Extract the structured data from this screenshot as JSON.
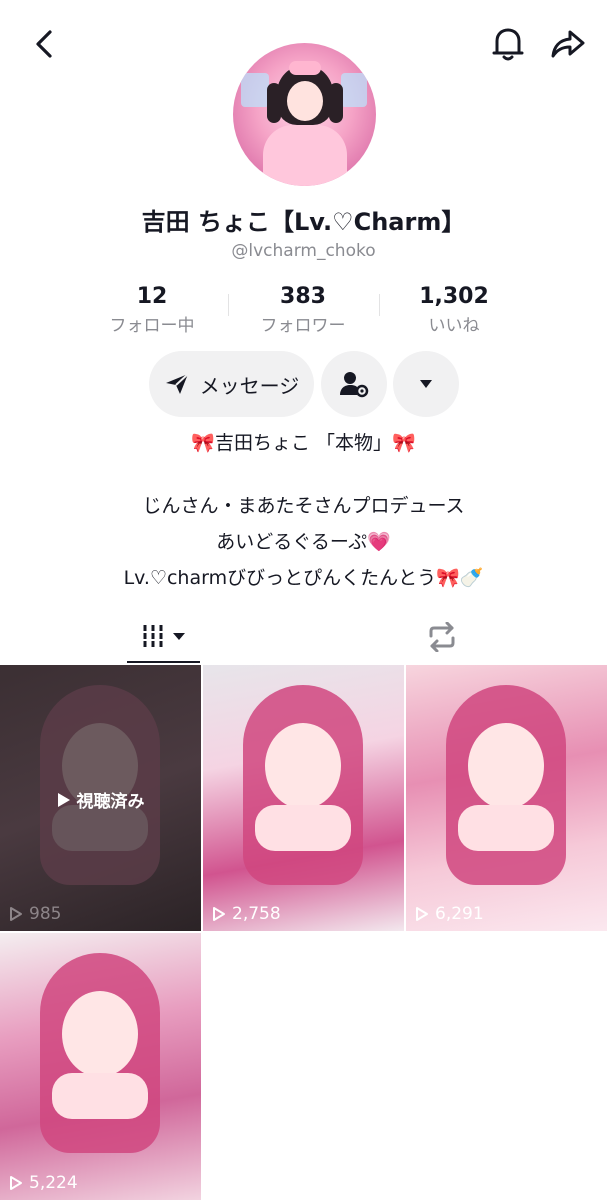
{
  "header": {
    "back_icon": "chevron-left-icon",
    "bell_icon": "bell-icon",
    "share_icon": "share-arrow-icon"
  },
  "profile": {
    "display_name": "吉田 ちょこ【Lv.♡Charm】",
    "handle": "@lvcharm_choko"
  },
  "stats": [
    {
      "value": "12",
      "label": "フォロー中"
    },
    {
      "value": "383",
      "label": "フォロワー"
    },
    {
      "value": "1,302",
      "label": "いいね"
    }
  ],
  "actions": {
    "message_label": "メッセージ"
  },
  "bio": {
    "title": "🎀吉田ちょこ 「本物」🎀",
    "lines": [
      "じんさん・まあたそさんプロデュース",
      "あいどるぐるーぷ💗",
      "Lv.♡charmびびっとぴんくたんとう🎀🍼"
    ]
  },
  "tabs": {
    "videos_icon": "grid-icon",
    "repost_icon": "repost-icon"
  },
  "videos": [
    {
      "views": "985",
      "watched_label": "視聴済み"
    },
    {
      "views": "2,758"
    },
    {
      "views": "6,291"
    },
    {
      "views": "5,224"
    }
  ],
  "colors": {
    "primary_text": "#161823",
    "secondary_text": "#8a8b91",
    "button_bg": "#f1f1f2"
  }
}
